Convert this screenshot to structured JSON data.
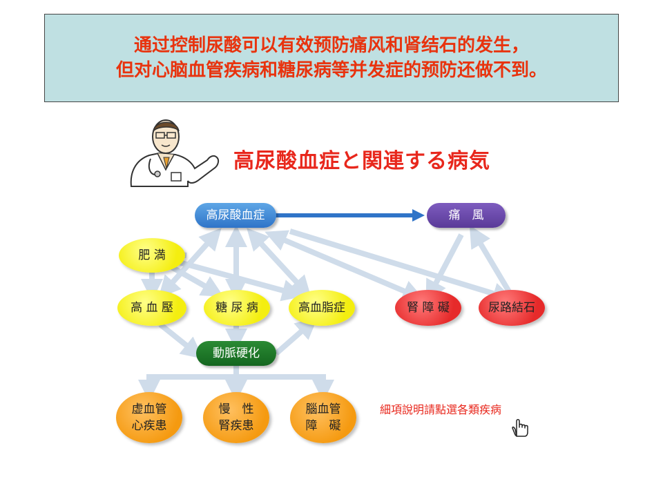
{
  "banner": {
    "line1": "通过控制尿酸可以有效预防痛风和肾结石的发生，",
    "line2": "但对心脑血管疾病和糖尿病等并发症的预防还做不到。"
  },
  "diagram": {
    "title": "高尿酸血症と関連する病気",
    "nodes": {
      "hyperuricemia": "高尿酸血症",
      "gout": "痛　風",
      "obesity": "肥 満",
      "hypertension": "高 血 壓",
      "diabetes": "糖 尿 病",
      "hyperlipidemia": "高血脂症",
      "kidney_disorder": "腎 障 礙",
      "urinary_stone": "尿路結石",
      "arteriosclerosis": "動脈硬化",
      "ischemic_heart": "虚血管\n心疾患",
      "chronic_kidney": "慢　性\n腎疾患",
      "cerebrovascular": "腦血管\n障　礙"
    },
    "note": "細項說明請點選各類疾病",
    "icons": {
      "doctor": "doctor-illustration",
      "cursor": "hand-pointer-icon"
    },
    "colors": {
      "banner_text": "#e8330e",
      "banner_bg": "#bfe0e2",
      "blue_node": "#3a80d0",
      "purple_node": "#5e3d9c",
      "green_node": "#1b7326",
      "yellow_node": "#f4ee10",
      "red_node": "#e62a2a",
      "orange_node": "#f59a10",
      "connector": "#cfdcea"
    }
  }
}
